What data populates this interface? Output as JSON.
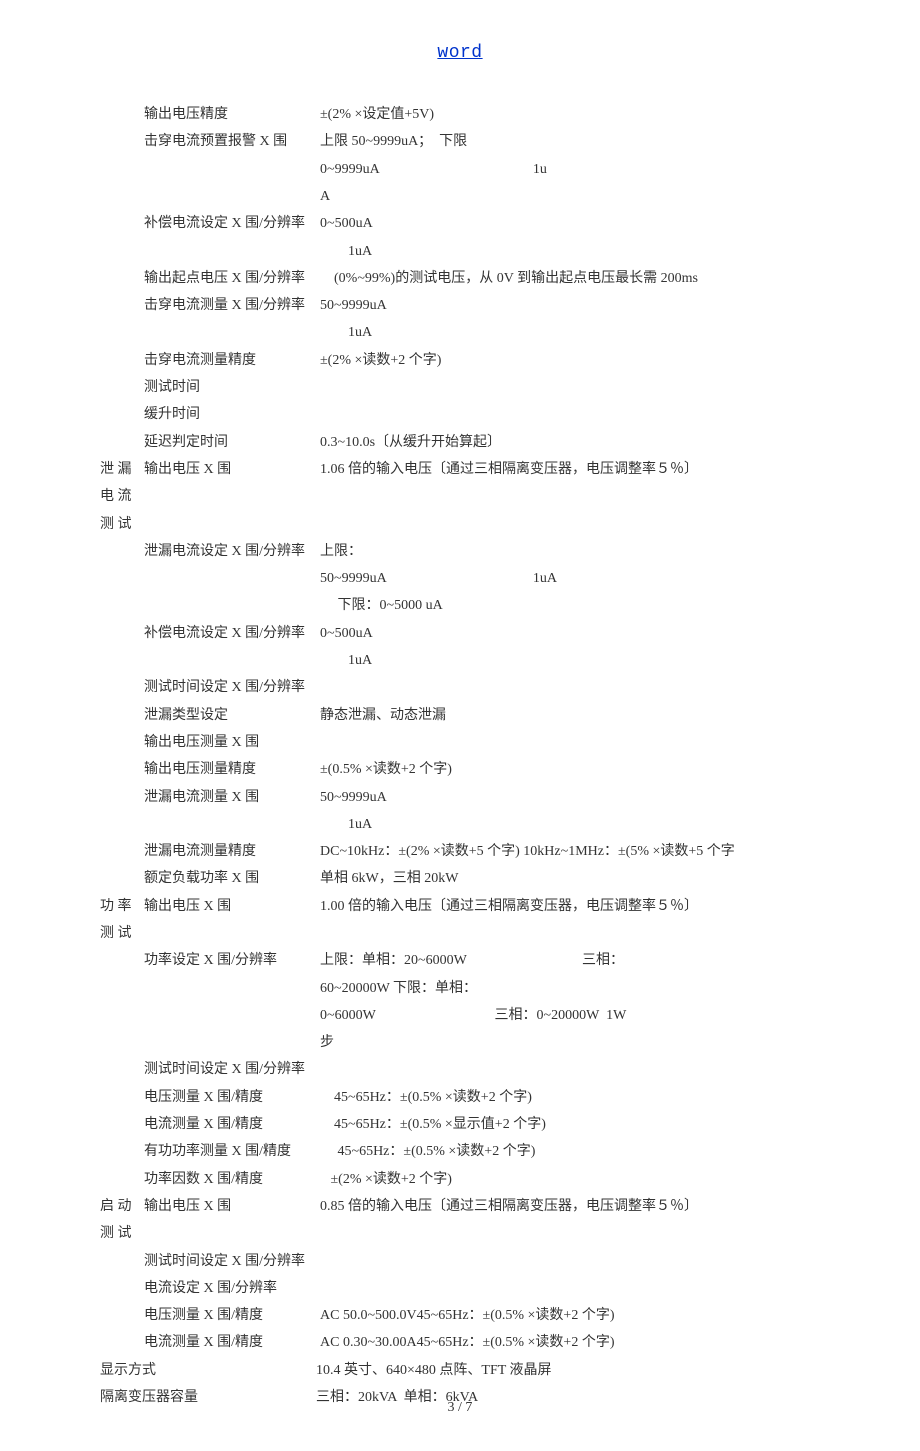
{
  "header": {
    "link_text": "word"
  },
  "footer": {
    "page_num": "3 / 7"
  },
  "groups": [
    {
      "category": "",
      "rows": [
        {
          "label": "输出电压精度",
          "value": "±(2% ×设定值+5V)"
        },
        {
          "label": "击穿电流预置报警 X 围",
          "value": "上限 50~9999uA；  下限\n0~9999uA                                            1u\nA"
        },
        {
          "label": "补偿电流设定 X 围/分辨率",
          "value": "0~500uA\n        1uA"
        },
        {
          "label": "输出起点电压 X 围/分辨率",
          "value": "    (0%~99%)的测试电压，从 0V 到输出起点电压最长需 200ms"
        },
        {
          "label": "击穿电流测量 X 围/分辨率",
          "value": "50~9999uA\n        1uA"
        },
        {
          "label": "击穿电流测量精度",
          "value": "±(2% ×读数+2 个字)"
        },
        {
          "label": "测试时间",
          "value": ""
        },
        {
          "label": "缓升时间",
          "value": ""
        },
        {
          "label": "延迟判定时间",
          "value": "0.3~10.0s〔从缓升开始算起〕"
        }
      ]
    },
    {
      "category": "泄 漏\n电 流\n测 试",
      "rows": [
        {
          "label": "输出电压 X 围",
          "value": "1.06 倍的输入电压〔通过三相隔离变压器，电压调整率５％〕"
        },
        {
          "label": "泄漏电流设定 X 围/分辨率",
          "value": "上限：\n50~9999uA                                          1uA\n     下限：0~5000 uA"
        },
        {
          "label": "补偿电流设定 X 围/分辨率",
          "value": "0~500uA\n        1uA"
        },
        {
          "label": "测试时间设定 X 围/分辨率",
          "value": ""
        },
        {
          "label": "泄漏类型设定",
          "value": "静态泄漏、动态泄漏"
        },
        {
          "label": "输出电压测量 X 围",
          "value": ""
        },
        {
          "label": "输出电压测量精度",
          "value": "±(0.5% ×读数+2 个字)"
        },
        {
          "label": "泄漏电流测量 X 围",
          "value": "50~9999uA\n        1uA"
        },
        {
          "label": "泄漏电流测量精度",
          "value": "DC~10kHz：±(2% ×读数+5 个字) 10kHz~1MHz：±(5% ×读数+5 个字"
        },
        {
          "label": "额定负载功率 X 围",
          "value": "单相 6kW，三相 20kW"
        }
      ]
    },
    {
      "category": "功 率\n测 试",
      "rows": [
        {
          "label": "输出电压 X 围",
          "value": "1.00 倍的输入电压〔通过三相隔离变压器，电压调整率５％〕"
        },
        {
          "label": "功率设定 X 围/分辨率",
          "value": "上限：单相：20~6000W                                 三相：\n60~20000W 下限：单相：\n0~6000W                                  三相：0~20000W  1W\n步"
        },
        {
          "label": "测试时间设定 X 围/分辨率",
          "value": ""
        },
        {
          "label": "电压测量 X 围/精度",
          "value": "    45~65Hz：±(0.5% ×读数+2 个字)"
        },
        {
          "label": "电流测量 X 围/精度",
          "value": "    45~65Hz：±(0.5% ×显示值+2 个字)"
        },
        {
          "label": "有功功率测量 X 围/精度",
          "value": "     45~65Hz：±(0.5% ×读数+2 个字)"
        },
        {
          "label": "功率因数 X 围/精度",
          "value": "   ±(2% ×读数+2 个字)"
        }
      ]
    },
    {
      "category": "启 动\n测 试",
      "rows": [
        {
          "label": "输出电压 X 围",
          "value": "0.85 倍的输入电压〔通过三相隔离变压器，电压调整率５％〕"
        },
        {
          "label": "测试时间设定 X 围/分辨率",
          "value": ""
        },
        {
          "label": "电流设定 X 围/分辨率",
          "value": ""
        },
        {
          "label": "电压测量 X 围/精度",
          "value": "AC 50.0~500.0V45~65Hz：±(0.5% ×读数+2 个字)"
        },
        {
          "label": "电流测量 X 围/精度",
          "value": "AC 0.30~30.00A45~65Hz：±(0.5% ×读数+2 个字)"
        }
      ]
    }
  ],
  "bottom": [
    {
      "label": "显示方式",
      "value": "10.4 英寸、640×480 点阵、TFT 液晶屏"
    },
    {
      "label": "隔离变压器容量",
      "value": "三相：20kVA  单相：6kVA"
    }
  ]
}
